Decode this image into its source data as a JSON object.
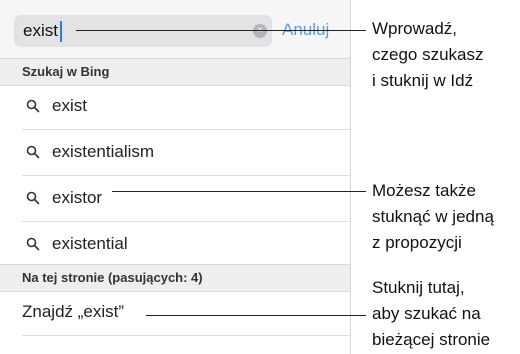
{
  "search": {
    "value": "exist",
    "cancel_label": "Anuluj",
    "clear_glyph": "×"
  },
  "bing_section": {
    "header": "Szukaj w Bing",
    "suggestions": [
      "exist",
      "existentialism",
      "existor",
      "existential"
    ]
  },
  "page_section": {
    "header": "Na tej stronie (pasujących: 4)",
    "find_label": "Znajdź „exist”"
  },
  "callouts": {
    "first": "Wprowadź,\nczego szukasz\ni stuknij w Idź",
    "second": "Możesz także\nstuknąć w jedną\nz propozycji",
    "third": "Stuknij tutaj,\naby szukać na\nbieżącej stronie"
  },
  "colors": {
    "accent": "#5e9ae8",
    "caret": "#2b7bf5"
  },
  "icons": {
    "suggestion": "magnifier-icon",
    "clear": "clear-circle-icon"
  }
}
